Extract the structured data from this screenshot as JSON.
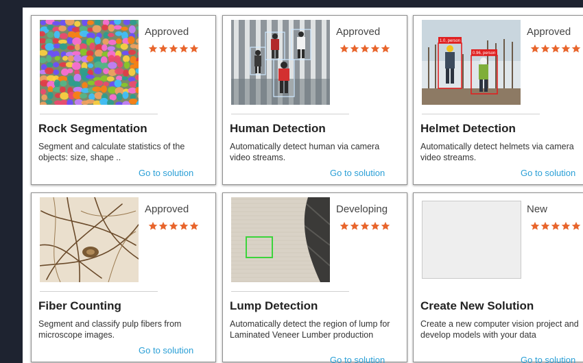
{
  "colors": {
    "star": "#e8652c",
    "link": "#2a9fd6"
  },
  "cards": [
    {
      "status": "Approved",
      "rating": 5,
      "title": "Rock Segmentation",
      "desc": "Segment and calculate statistics of the objects: size, shape ..",
      "link": "Go to solution",
      "icon": "rock-segmentation-image"
    },
    {
      "status": "Approved",
      "rating": 5,
      "title": "Human Detection",
      "desc": "Automatically detect human via camera video streams.",
      "link": "Go to solution",
      "icon": "human-detection-image"
    },
    {
      "status": "Approved",
      "rating": 5,
      "title": "Helmet Detection",
      "desc": "Automatically detect helmets via camera video streams.",
      "link": "Go to solution",
      "icon": "helmet-detection-image",
      "labels": [
        "1.0, person",
        "0.96, person"
      ]
    },
    {
      "status": "Approved",
      "rating": 5,
      "title": "Fiber Counting",
      "desc": "Segment and classify pulp fibers from microscope images.",
      "link": "Go to solution",
      "icon": "fiber-counting-image"
    },
    {
      "status": "Developing",
      "rating": 5,
      "title": "Lump Detection",
      "desc": "Automatically detect the region of lump for Laminated Veneer Lumber production",
      "link": "Go to solution",
      "icon": "lump-detection-image"
    },
    {
      "status": "New",
      "rating": 5,
      "title": "Create New Solution",
      "desc": "Create a new computer vision project and develop models with your data",
      "link": "Go to solution",
      "icon": "blank-placeholder-image"
    }
  ]
}
